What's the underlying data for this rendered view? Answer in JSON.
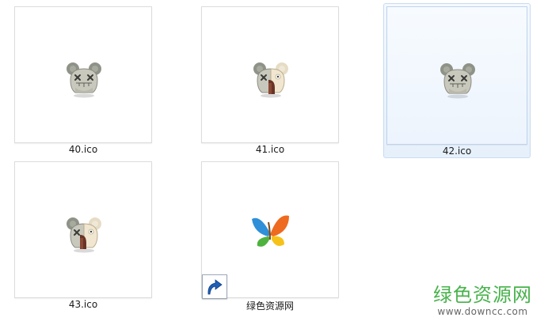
{
  "files": [
    {
      "name": "40.ico",
      "icon": "kaws-companion-icon",
      "selected": false
    },
    {
      "name": "41.ico",
      "icon": "kaws-companion-flayed-icon",
      "selected": false
    },
    {
      "name": "42.ico",
      "icon": "kaws-companion-icon",
      "selected": true
    },
    {
      "name": "43.ico",
      "icon": "kaws-companion-flayed-icon",
      "selected": false
    },
    {
      "name": "绿色资源网",
      "icon": "msn-butterfly-icon",
      "selected": false,
      "shortcut": true
    }
  ],
  "watermark": {
    "title": "绿色资源网",
    "url": "www.downcc.com"
  },
  "colors": {
    "selection_background": "#e6f0fb",
    "selection_border": "#c7dcf1",
    "watermark_green": "#47b24b"
  }
}
